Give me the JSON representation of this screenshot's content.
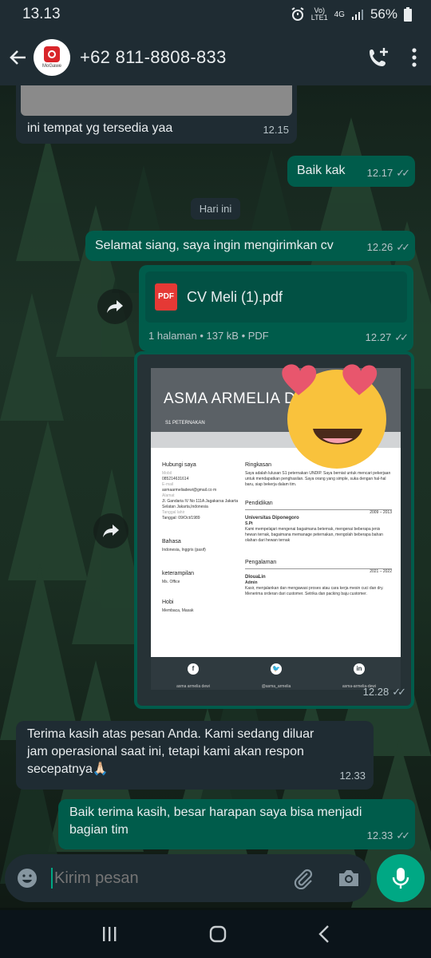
{
  "status": {
    "time": "13.13",
    "network_top": "Vo)",
    "network_bottom": "LTE1",
    "network_type": "4G",
    "battery": "56%"
  },
  "header": {
    "avatar_text": "MoGawe",
    "contact": "+62 811-8808-833"
  },
  "messages": {
    "m1": {
      "text": "ini tempat yg tersedia yaa",
      "time": "12.15"
    },
    "m2": {
      "text": "Baik kak",
      "time": "12.17"
    },
    "date_chip": "Hari ini",
    "m3": {
      "text": "Selamat siang, saya ingin mengirimkan cv",
      "time": "12.26"
    },
    "m4": {
      "icon_label": "PDF",
      "file_name": "CV Meli (1).pdf",
      "info": "1 halaman • 137 kB • PDF",
      "time": "12.27"
    },
    "m5": {
      "time": "12.28"
    },
    "m6": {
      "text": "Terima kasih atas pesan Anda. Kami sedang diluar jam operasional saat ini, tetapi kami akan respon secepatnya🙏🏻",
      "time": "12.33"
    },
    "m7": {
      "text": "Baik terima kasih, besar harapan saya bisa menjadi bagian tim",
      "time": "12.33"
    }
  },
  "cv": {
    "name": "ASMA ARMELIA D",
    "subtitle": "S1 PETERNAKAN",
    "contact_heading": "Hubungi saya",
    "mobile_label": "Mobil",
    "mobile": "085214631614",
    "email_label": "E-mail",
    "email": "asmaarmeliadewi@gmail.co m",
    "address_label": "Alamat",
    "address": "Jl. Gandaria IV No 111A Jagakarsa Jakarta Selatan Jakarta,Indonesia",
    "birth_label": "Tanggal lahir",
    "birth": "Tanggal: 09/Oct/1989",
    "lang_heading": "Bahasa",
    "lang": "Indonesia, Inggris (pasif)",
    "skills_heading": "keterampilan",
    "skills": "Ms. Office",
    "hobby_heading": "Hobi",
    "hobby": "Membaca, Masak",
    "summary_heading": "Ringkasan",
    "summary": "Saya adalah lulusan S1 peternakan UNDIP. Saya berniat untuk mencari pekerjaan untuk mendapatkan penghasilan. Saya orang yang simple, suka dengan hal-hal baru, siap bekerja dalam tim.",
    "edu_heading": "Pendidikan",
    "edu_years": "2009 – 2013",
    "edu_school": "Universitas Diponegoro",
    "edu_degree": "S.Pt",
    "edu_desc": "Kami mempelajari mengenai bagaimana beternak, mengenai beberapa jenis hewan ternak, bagaimana memanage peternakan, mengolah beberapa bahan olahan dari hewan ternak",
    "exp_heading": "Pengalaman",
    "exp_years": "2021 – 2022",
    "exp_company": "DlouaLin",
    "exp_role": "Admin",
    "exp_desc": "Kasir, menjalankan dan mengawasi proses atau cara kerja mesin cuci dan dry. Menerima orderan dari customer. Setrika dan packing baju customer.",
    "foot_fb": "asma armelia dewi",
    "foot_tw": "@asma_armelia",
    "foot_in": "asma-armelia-dewi",
    "icon_fb": "f",
    "icon_in": "in"
  },
  "composer": {
    "placeholder": "Kirim pesan"
  },
  "colors": {
    "incoming": "#1f2c33",
    "outgoing": "#005c4b",
    "accent": "#00a884"
  }
}
